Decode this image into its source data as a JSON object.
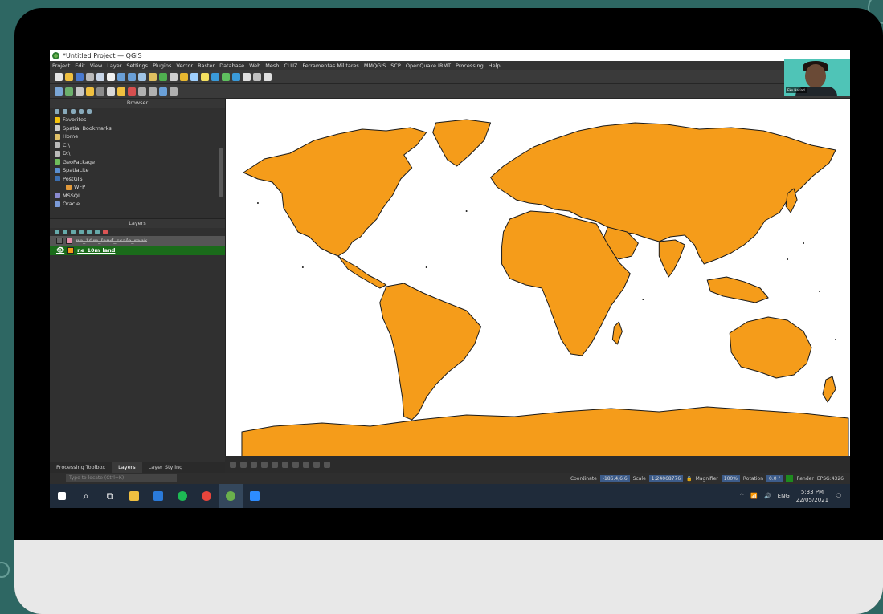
{
  "window": {
    "title": "*Untitled Project — QGIS"
  },
  "menu": [
    "Project",
    "Edit",
    "View",
    "Layer",
    "Settings",
    "Plugins",
    "Vector",
    "Raster",
    "Database",
    "Web",
    "Mesh",
    "CLUZ",
    "Ferramentas Militares",
    "MMQGIS",
    "SCP",
    "OpenQuake IRMT",
    "Processing",
    "Help"
  ],
  "webcam": {
    "name": "Eko Hariad"
  },
  "browser": {
    "title": "Browser",
    "items": [
      {
        "label": "Favorites",
        "icon": "star-icon"
      },
      {
        "label": "Spatial Bookmarks",
        "icon": "bookmark-icon"
      },
      {
        "label": "Home",
        "icon": "home-folder-icon"
      },
      {
        "label": "C:\\",
        "icon": "drive-icon"
      },
      {
        "label": "D:\\",
        "icon": "drive-icon"
      },
      {
        "label": "GeoPackage",
        "icon": "geopackage-icon"
      },
      {
        "label": "SpatiaLite",
        "icon": "spatialite-icon"
      },
      {
        "label": "PostGIS",
        "icon": "postgis-icon"
      },
      {
        "label": "WFP",
        "icon": "wfp-icon"
      },
      {
        "label": "MSSQL",
        "icon": "mssql-icon"
      },
      {
        "label": "Oracle",
        "icon": "oracle-icon"
      }
    ]
  },
  "layers": {
    "title": "Layers",
    "items": [
      {
        "name": "ne_10m_land_scale_rank",
        "color": "#e58fa8",
        "visible": false
      },
      {
        "name": "ne_10m_land",
        "color": "#f59c1a",
        "visible": true
      }
    ]
  },
  "bottom_tabs": [
    "Processing Toolbox",
    "Layers",
    "Layer Styling"
  ],
  "status": {
    "locate_placeholder": "Type to locate (Ctrl+K)",
    "coordinate_label": "Coordinate",
    "coordinate": "-186.4,6.6",
    "scale_label": "Scale",
    "scale": "1:24068776",
    "magnifier_label": "Magnifier",
    "magnifier": "100%",
    "rotation_label": "Rotation",
    "rotation": "0.0 °",
    "render_label": "Render",
    "crs": "EPSG:4326"
  },
  "tray": {
    "time": "5:33 PM",
    "date": "22/05/2021",
    "lang": "ENG"
  },
  "map": {
    "land_color": "#f59c1a",
    "outline_color": "#1a1a1a",
    "background": "#ffffff"
  }
}
